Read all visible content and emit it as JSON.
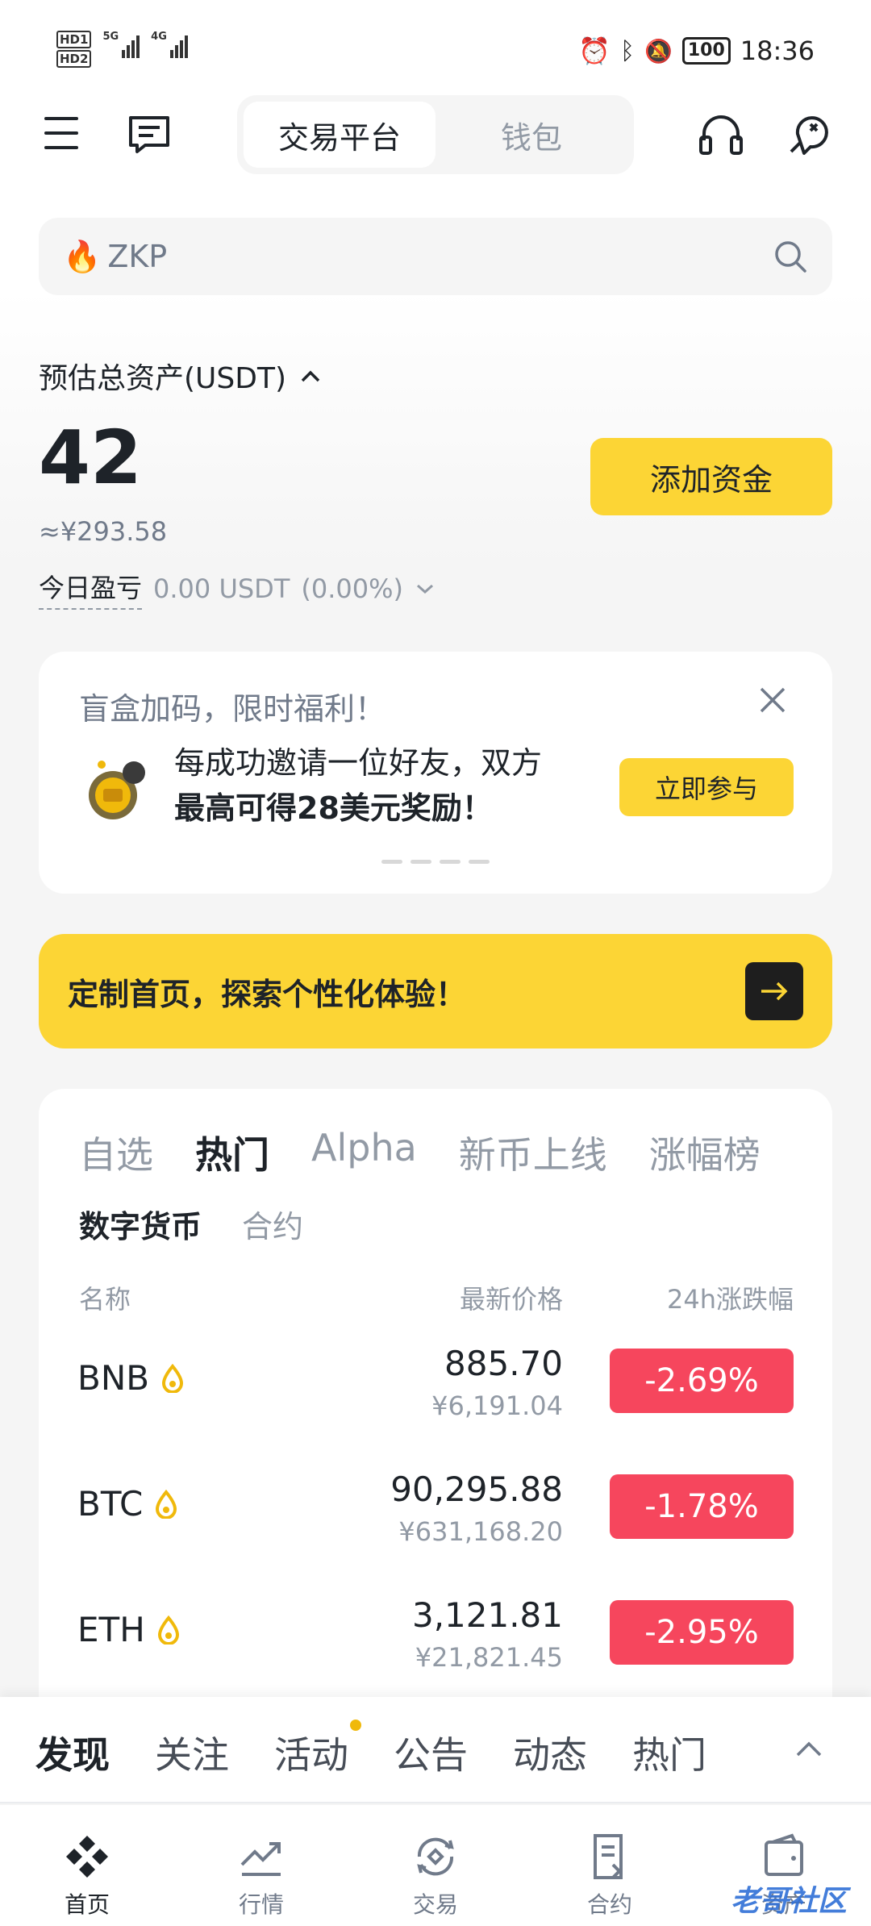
{
  "status_bar": {
    "hd1": "HD1",
    "hd2": "HD2",
    "net1": "5G",
    "net2": "4G",
    "battery": "100",
    "time": "18:36"
  },
  "header": {
    "tabs": [
      {
        "label": "交易平台",
        "active": true
      },
      {
        "label": "钱包",
        "active": false
      }
    ]
  },
  "search": {
    "placeholder": "ZKP"
  },
  "assets": {
    "label": "预估总资产(USDT)",
    "total": "42",
    "approx_cny": "≈¥293.58",
    "pnl_label": "今日盈亏",
    "pnl_value": "0.00 USDT",
    "pnl_percent": "(0.00%)",
    "add_funds_label": "添加资金"
  },
  "promo": {
    "title": "盲盒加码，限时福利！",
    "text_line1": "每成功邀请一位好友，双方",
    "text_line2": "最高可得28美元奖励！",
    "button_label": "立即参与"
  },
  "custom_banner": {
    "text": "定制首页，探索个性化体验！"
  },
  "market": {
    "tabs": [
      "自选",
      "热门",
      "Alpha",
      "新币上线",
      "涨幅榜"
    ],
    "active_tab": "热门",
    "subtabs": [
      "数字货币",
      "合约"
    ],
    "active_subtab": "数字货币",
    "col_name": "名称",
    "col_price": "最新价格",
    "col_change": "24h涨跌幅",
    "rows": [
      {
        "coin": "BNB",
        "price": "885.70",
        "cny": "¥6,191.04",
        "change": "-2.69%"
      },
      {
        "coin": "BTC",
        "price": "90,295.88",
        "cny": "¥631,168.20",
        "change": "-1.78%"
      },
      {
        "coin": "ETH",
        "price": "3,121.81",
        "cny": "¥21,821.45",
        "change": "-2.95%"
      }
    ]
  },
  "feed": {
    "tabs": [
      "发现",
      "关注",
      "活动",
      "公告",
      "动态",
      "热门"
    ],
    "active": "发现"
  },
  "bottom_nav": [
    {
      "label": "首页",
      "icon": "home-icon",
      "active": true
    },
    {
      "label": "行情",
      "icon": "markets-icon",
      "active": false
    },
    {
      "label": "交易",
      "icon": "trade-icon",
      "active": false
    },
    {
      "label": "合约",
      "icon": "futures-icon",
      "active": false
    },
    {
      "label": "资产",
      "icon": "wallet-icon",
      "active": false
    }
  ],
  "watermark": "老哥社区",
  "colors": {
    "brand_yellow": "#fcd535",
    "down_red": "#f6465d",
    "text_primary": "#1e2329",
    "text_secondary": "#929aa5"
  }
}
